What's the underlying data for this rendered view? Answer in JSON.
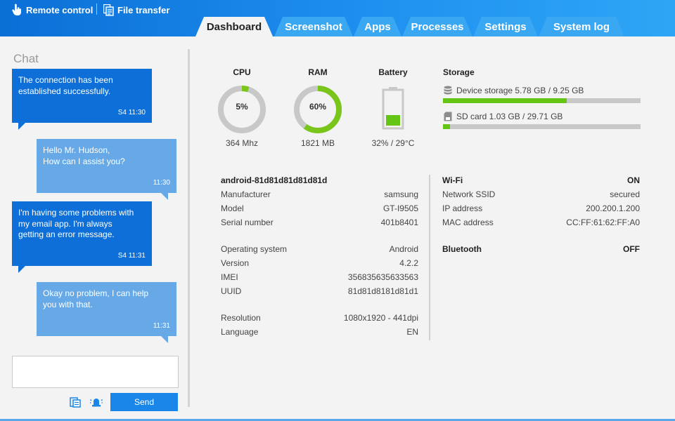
{
  "toolbar": {
    "remote_control": "Remote control",
    "file_transfer": "File transfer"
  },
  "tabs": [
    "Dashboard",
    "Screenshot",
    "Apps",
    "Processes",
    "Settings",
    "System log"
  ],
  "active_tab": "Dashboard",
  "chat": {
    "title": "Chat",
    "messages": [
      {
        "dir": "in",
        "lines": [
          "The connection has been",
          "established successfully."
        ],
        "time": "S4 11:30"
      },
      {
        "dir": "out",
        "lines": [
          "Hello Mr. Hudson,",
          "How can I assist you?"
        ],
        "time": "11:30"
      },
      {
        "dir": "in",
        "lines": [
          "I'm having some problems with",
          "my email app. I'm always",
          "getting an error message."
        ],
        "time": "S4 11:31"
      },
      {
        "dir": "out",
        "lines": [
          "Okay no problem, I can help",
          "you with that."
        ],
        "time": "11:31"
      }
    ],
    "input_value": "",
    "send_label": "Send"
  },
  "metrics": {
    "cpu": {
      "label": "CPU",
      "percent_text": "5%",
      "percent": 5,
      "sub": "364 Mhz"
    },
    "ram": {
      "label": "RAM",
      "percent_text": "60%",
      "percent": 60,
      "sub": "1821 MB"
    },
    "battery": {
      "label": "Battery",
      "level": 32,
      "sub": "32% / 29°C"
    }
  },
  "storage": {
    "title": "Storage",
    "items": [
      {
        "label": "Device storage 5.78 GB / 9.25 GB",
        "fill": 0.625
      },
      {
        "label": "SD card 1.03 GB / 29.71 GB",
        "fill": 0.035
      }
    ]
  },
  "device": {
    "name": "android-81d81d81d81d81d",
    "rows": [
      [
        "Manufacturer",
        "samsung"
      ],
      [
        "Model",
        "GT-I9505"
      ],
      [
        "Serial number",
        "401b8401"
      ],
      [
        "Operating system",
        "Android"
      ],
      [
        "Version",
        "4.2.2"
      ],
      [
        "IMEI",
        "356835635633563"
      ],
      [
        "UUID",
        "81d81d8181d81d1"
      ],
      [
        "Resolution",
        "1080x1920 - 441dpi"
      ],
      [
        "Language",
        "EN"
      ]
    ]
  },
  "network": {
    "wifi_label": "Wi-Fi",
    "wifi_status": "ON",
    "rows": [
      [
        "Network SSID",
        "secured"
      ],
      [
        "IP address",
        "200.200.1.200"
      ],
      [
        "MAC address",
        "CC:FF:61:62:FF:A0"
      ]
    ],
    "bluetooth_label": "Bluetooth",
    "bluetooth_status": "OFF"
  },
  "colors": {
    "accent_blue": "#1a86ea",
    "gauge_green": "#7ac51a",
    "track_gray": "#c8c8c8"
  }
}
